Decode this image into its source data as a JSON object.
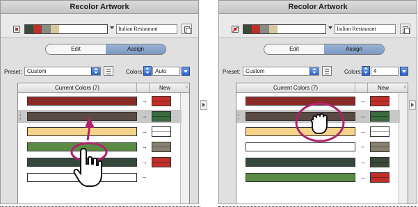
{
  "panels": [
    {
      "title": "Recolor Artwork",
      "current_swatch": "#c0302a",
      "strip_colors": [
        "#3a4a38",
        "#c0302a",
        "#8a8a80",
        "#d8c8a0",
        "#ffffff"
      ],
      "name_value": "Italian Restaurant",
      "tabs": [
        "Edit",
        "Assign"
      ],
      "active_tab": "Assign",
      "preset_label": "Preset:",
      "preset_value": "Custom",
      "colors_label": "Colors:",
      "colors_value": "Auto",
      "table_header_current": "Current Colors (7)",
      "table_header_new": "New",
      "rows": [
        {
          "current": "#8a2a26",
          "symbol": "→",
          "new": "#c0302a"
        },
        {
          "current": "#5a4a44",
          "symbol": "→",
          "new": "#3a6a40"
        },
        {
          "current": "#f6d38a",
          "symbol": "→",
          "new": "#ffffff"
        },
        {
          "current": "#5a8a44",
          "symbol": "→",
          "new": "#8a8070"
        },
        {
          "current": "#34483c",
          "symbol": "→",
          "new": "#c0302a"
        },
        {
          "current": "#ffffff",
          "symbol": "–",
          "new": ""
        }
      ]
    },
    {
      "title": "Recolor Artwork",
      "current_swatch": "#c0302a",
      "strip_colors": [
        "#3a4a38",
        "#c0302a",
        "#8a8a80",
        "#d8c8a0",
        "#ffffff"
      ],
      "name_value": "Italian Restaurant",
      "tabs": [
        "Edit",
        "Assign"
      ],
      "active_tab": "Assign",
      "preset_label": "Preset:",
      "preset_value": "Custom",
      "colors_label": "Colors:",
      "colors_value": "4",
      "table_header_current": "Current Colors (7)",
      "table_header_new": "New",
      "rows": [
        {
          "current": "#8a2a26",
          "symbol": "→",
          "new": "#c0302a"
        },
        {
          "current": "#5a4a44",
          "symbol": "→",
          "new": "#3a6a40"
        },
        {
          "current": "#f6d38a",
          "symbol": "→",
          "new": "#ffffff"
        },
        {
          "current": "#ffffff",
          "symbol": "–",
          "new": "#8a8070"
        },
        {
          "current": "#34483c",
          "symbol": "→",
          "new": "#3a4a38"
        },
        {
          "current": "#5a8a44",
          "symbol": "→",
          "new": "#c0302a"
        }
      ]
    }
  ],
  "annotation_color": "#b0226a"
}
